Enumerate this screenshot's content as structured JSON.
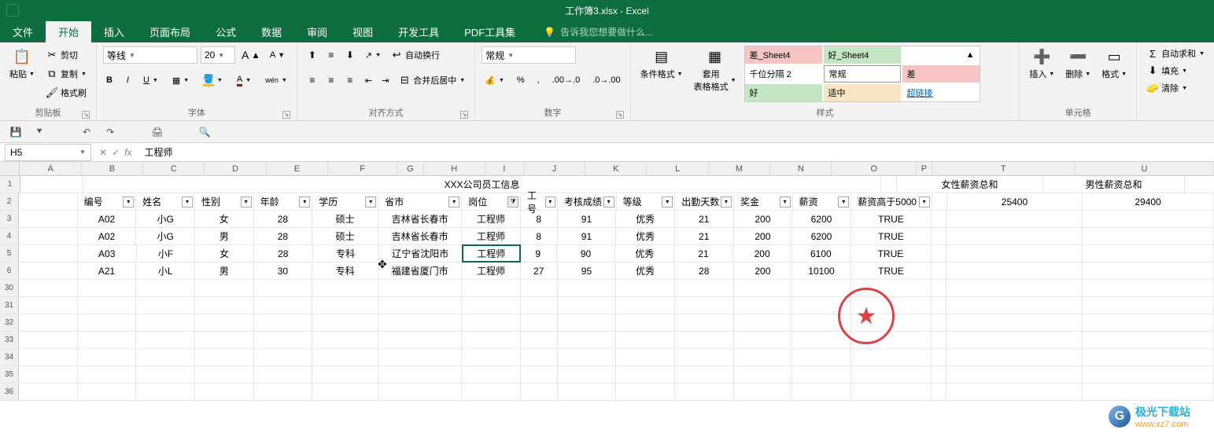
{
  "window": {
    "title": "工作簿3.xlsx - Excel"
  },
  "tabs": {
    "file": "文件",
    "home": "开始",
    "insert": "插入",
    "layout": "页面布局",
    "formulas": "公式",
    "data": "数据",
    "review": "审阅",
    "view": "视图",
    "dev": "开发工具",
    "pdf": "PDF工具集",
    "tell": "告诉我您想要做什么..."
  },
  "ribbon": {
    "clipboard": {
      "paste": "粘贴",
      "cut": "剪切",
      "copy": "复制",
      "brush": "格式刷",
      "group": "剪贴板"
    },
    "font": {
      "name": "等线",
      "size": "20",
      "group": "字体"
    },
    "align": {
      "wrap": "自动换行",
      "merge": "合并后居中",
      "group": "对齐方式"
    },
    "number": {
      "format": "常规",
      "group": "数字"
    },
    "styles": {
      "cond": "条件格式",
      "table": "套用\n表格格式",
      "bad": "差_Sheet4",
      "good": "好_Sheet4",
      "comma": "千位分隔 2",
      "normal": "常规",
      "bad2": "差",
      "good2": "好",
      "warn": "适中",
      "link": "超链接",
      "group": "样式"
    },
    "cells": {
      "insert": "插入",
      "delete": "删除",
      "format": "格式",
      "group": "单元格"
    },
    "editing": {
      "sum": "自动求和",
      "fill": "填充",
      "clear": "清除"
    }
  },
  "namebox": "H5",
  "formula": "工程师",
  "sheet": {
    "title": "XXX公司员工信息",
    "headers": {
      "b": "编号",
      "c": "姓名",
      "d": "性别",
      "e": "年龄",
      "f": "学历",
      "g": "省市",
      "h": "岗位",
      "i": "工号",
      "j": "考核成绩",
      "k": "等级",
      "l": "出勤天数",
      "m": "奖金",
      "n": "薪资",
      "o": "薪资高于5000",
      "t": "女性薪资总和",
      "u": "男性薪资总和"
    },
    "sumT": "25400",
    "sumU": "29400",
    "rows": [
      {
        "b": "A02",
        "c": "小G",
        "d": "女",
        "e": "28",
        "f": "硕士",
        "g": "吉林省长春市",
        "h": "工程师",
        "i": "8",
        "j": "91",
        "k": "优秀",
        "l": "21",
        "m": "200",
        "n": "6200",
        "o": "TRUE"
      },
      {
        "b": "A02",
        "c": "小G",
        "d": "男",
        "e": "28",
        "f": "硕士",
        "g": "吉林省长春市",
        "h": "工程师",
        "i": "8",
        "j": "91",
        "k": "优秀",
        "l": "21",
        "m": "200",
        "n": "6200",
        "o": "TRUE"
      },
      {
        "b": "A03",
        "c": "小F",
        "d": "女",
        "e": "28",
        "f": "专科",
        "g": "辽宁省沈阳市",
        "h": "工程师",
        "i": "9",
        "j": "90",
        "k": "优秀",
        "l": "21",
        "m": "200",
        "n": "6100",
        "o": "TRUE"
      },
      {
        "b": "A21",
        "c": "小L",
        "d": "男",
        "e": "30",
        "f": "专科",
        "g": "福建省厦门市",
        "h": "工程师",
        "i": "27",
        "j": "95",
        "k": "优秀",
        "l": "28",
        "m": "200",
        "n": "10100",
        "o": "TRUE"
      }
    ],
    "rownums": [
      "1",
      "2",
      "3",
      "4",
      "5",
      "6",
      "30",
      "31",
      "32",
      "33",
      "34",
      "35",
      "36"
    ]
  },
  "watermark": {
    "t1": "极光下载站",
    "t2": "www.xz7.com"
  }
}
